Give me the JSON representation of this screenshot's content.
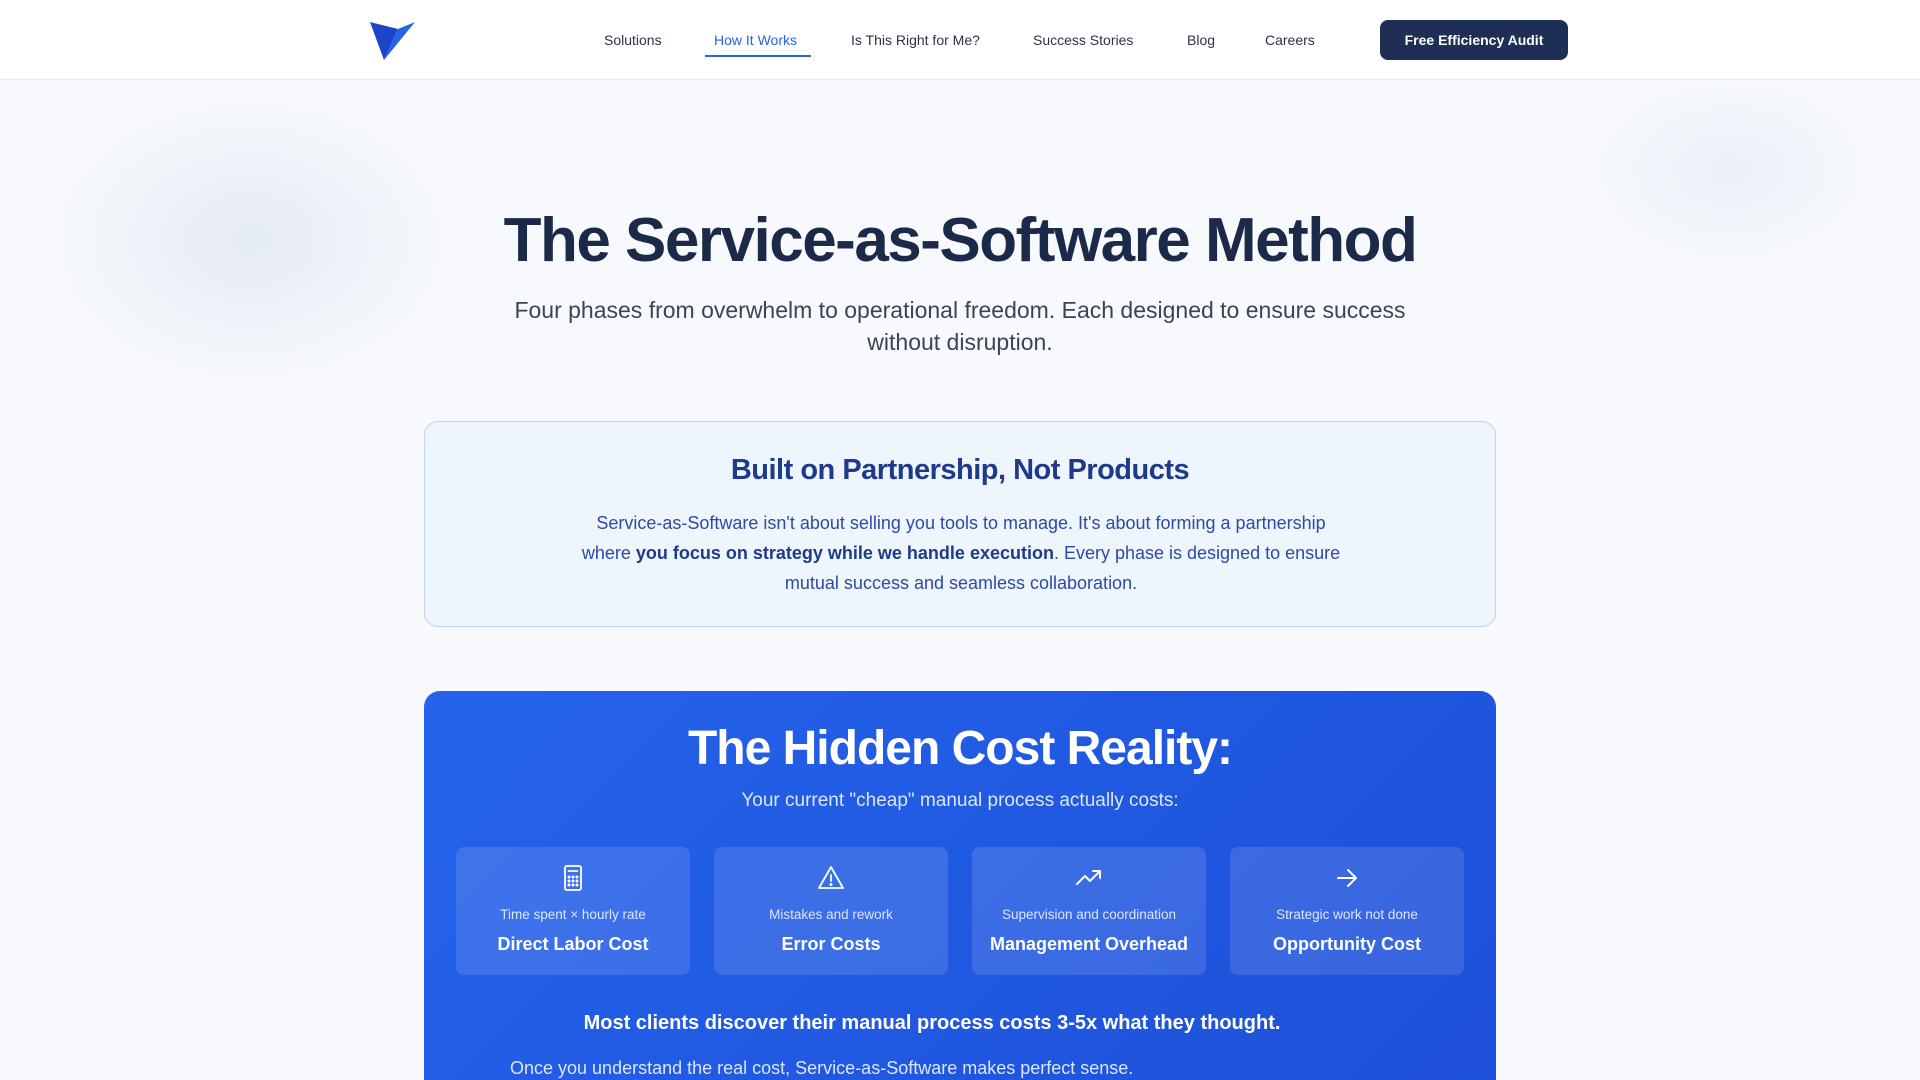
{
  "header": {
    "logo_icon": "brand-v-logo",
    "nav": [
      {
        "label": "Solutions"
      },
      {
        "label": "How It Works",
        "active": true
      },
      {
        "label": "Is This Right for Me?"
      },
      {
        "label": "Success Stories"
      },
      {
        "label": "Blog"
      },
      {
        "label": "Careers"
      }
    ],
    "cta_label": "Free Efficiency Audit"
  },
  "hero": {
    "title": "The Service-as-Software Method",
    "subtitle": "Four phases from overwhelm to operational freedom. Each designed to ensure success without disruption."
  },
  "partnership": {
    "title": "Built on Partnership, Not Products",
    "text_before": "Service-as-Software isn't about selling you tools to manage. It's about forming a partnership where ",
    "text_bold": "you focus on strategy while we handle execution",
    "text_after": ". Every phase is designed to ensure mutual success and seamless collaboration."
  },
  "hidden_cost": {
    "title": "The Hidden Cost Reality:",
    "subtitle": "Your current \"cheap\" manual process actually costs:",
    "cards": [
      {
        "icon": "calculator-icon",
        "desc": "Time spent × hourly rate",
        "name": "Direct Labor Cost"
      },
      {
        "icon": "warning-triangle-icon",
        "desc": "Mistakes and rework",
        "name": "Error Costs"
      },
      {
        "icon": "trending-up-icon",
        "desc": "Supervision and coordination",
        "name": "Management Overhead"
      },
      {
        "icon": "arrow-right-icon",
        "desc": "Strategic work not done",
        "name": "Opportunity Cost"
      }
    ],
    "note": "Most clients discover their manual process costs 3-5x what they thought.",
    "footer": "Once you understand the real cost, Service-as-Software makes perfect sense."
  },
  "colors": {
    "accent": "#2563eb",
    "navy": "#1e2f55",
    "title": "#1b2a48",
    "card_bg": "#eff5fd"
  }
}
